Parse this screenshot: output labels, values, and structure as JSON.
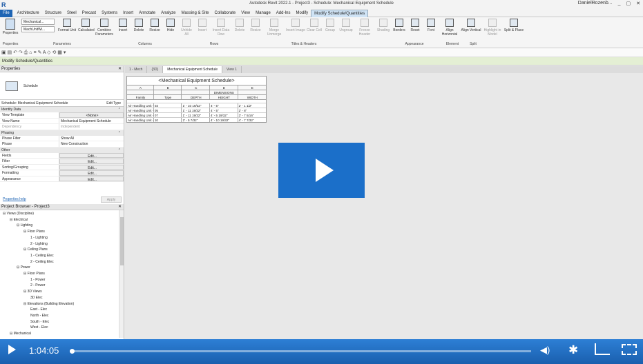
{
  "app": {
    "logo": "R",
    "title": "Autodesk Revit 2022.1 - Project3 - Schedule: Mechanical Equipment Schedule",
    "user": "DanielRozenb...",
    "window_controls": [
      "_",
      "▢",
      "✕"
    ]
  },
  "tabs": [
    "File",
    "Architecture",
    "Structure",
    "Steel",
    "Precast",
    "Systems",
    "Insert",
    "Annotate",
    "Analyze",
    "Massing & Site",
    "Collaborate",
    "View",
    "Manage",
    "Add-Ins",
    "Modify",
    "Modify Schedule/Quantities"
  ],
  "ribbon": {
    "properties_label": "Properties",
    "param_dropdown_1": "Mechanical...",
    "param_dropdown_2": "MachUnitWi...",
    "buttons": [
      "Format Unit",
      "Calculated",
      "Combine Parameters",
      "Insert",
      "Delete",
      "Resize",
      "Hide",
      "Unhide All",
      "Insert",
      "Insert Data Row",
      "Delete",
      "Resize",
      "Merge Unmerge",
      "Insert Image",
      "Clear Cell",
      "Group",
      "Ungroup",
      "Freeze Header",
      "Shading",
      "Borders",
      "Reset",
      "Font",
      "Align Horizontal",
      "Align Vertical",
      "Highlight in Model",
      "Split & Place"
    ],
    "groups": [
      "Properties",
      "Parameters",
      "Columns",
      "Rows",
      "Titles & Headers",
      "Appearance",
      "Element",
      "Split"
    ]
  },
  "context_bar": "Modify Schedule/Quantities",
  "properties": {
    "header": "Properties",
    "type_name": "Schedule",
    "filter_value": "Schedule: Mechanical Equipment Schedule",
    "edit_type": "Edit Type",
    "sections": [
      {
        "name": "Identity Data",
        "rows": [
          [
            "View Template",
            "<None>"
          ],
          [
            "View Name",
            "Mechanical Equipment Schedule"
          ],
          [
            "Dependency",
            "Independent"
          ]
        ]
      },
      {
        "name": "Phasing",
        "rows": [
          [
            "Phase Filter",
            "Show All"
          ],
          [
            "Phase",
            "New Construction"
          ]
        ]
      },
      {
        "name": "Other",
        "rows": [
          [
            "Fields",
            "Edit..."
          ],
          [
            "Filter",
            "Edit..."
          ],
          [
            "Sorting/Grouping",
            "Edit..."
          ],
          [
            "Formatting",
            "Edit..."
          ],
          [
            "Appearance",
            "Edit..."
          ]
        ]
      }
    ],
    "help_link": "Properties help",
    "apply": "Apply"
  },
  "browser": {
    "header": "Project Browser - Project3",
    "nodes": [
      {
        "t": "Views (Discipline)",
        "d": 0
      },
      {
        "t": "Electrical",
        "d": 1
      },
      {
        "t": "Lighting",
        "d": 2
      },
      {
        "t": "Floor Plans",
        "d": 3
      },
      {
        "t": "1 - Lighting",
        "d": 4
      },
      {
        "t": "2 - Lighting",
        "d": 4
      },
      {
        "t": "Ceiling Plans",
        "d": 3
      },
      {
        "t": "1 - Ceiling Elec",
        "d": 4
      },
      {
        "t": "2 - Ceiling Elec",
        "d": 4
      },
      {
        "t": "Power",
        "d": 2
      },
      {
        "t": "Floor Plans",
        "d": 3
      },
      {
        "t": "1 - Power",
        "d": 4
      },
      {
        "t": "2 - Power",
        "d": 4
      },
      {
        "t": "3D Views",
        "d": 3
      },
      {
        "t": "3D Elec",
        "d": 4
      },
      {
        "t": "Elevations (Building Elevation)",
        "d": 3
      },
      {
        "t": "East - Elec",
        "d": 4
      },
      {
        "t": "North - Elec",
        "d": 4
      },
      {
        "t": "South - Elec",
        "d": 4
      },
      {
        "t": "West - Elec",
        "d": 4
      },
      {
        "t": "Mechanical",
        "d": 1
      }
    ]
  },
  "view_tabs": [
    "1 - Mech",
    "{3D}",
    "Mechanical Equipment Schedule",
    "View 1"
  ],
  "schedule": {
    "title": "<Mechanical Equipment Schedule>",
    "letters": [
      "A",
      "B",
      "C",
      "D",
      "E"
    ],
    "group_header": "DIMENSIONS",
    "headers": [
      "Family",
      "Type",
      "DEPTH",
      "HEIGHT",
      "WIDTH"
    ],
    "rows": [
      [
        "Air Handling Unit - ",
        "03",
        "1' - 10 19/32\"",
        "4' - 5\"",
        "2' - 1 1/2\""
      ],
      [
        "Air Handling Unit - ",
        "05",
        "1' - 11 19/32\"",
        "4' - 5\"",
        "2' - 8\""
      ],
      [
        "Air Handling Unit - ",
        "07",
        "1' - 11 19/32\"",
        "4' - 5 19/32\"",
        "3' - 7 5/16\""
      ],
      [
        "Air Handling Unit - ",
        "10",
        "2' - 5 7/32\"",
        "4' - 10 19/32\"",
        "4' - 7 7/32\""
      ]
    ]
  },
  "player": {
    "time": "1:04:05",
    "progress": 0.004
  }
}
